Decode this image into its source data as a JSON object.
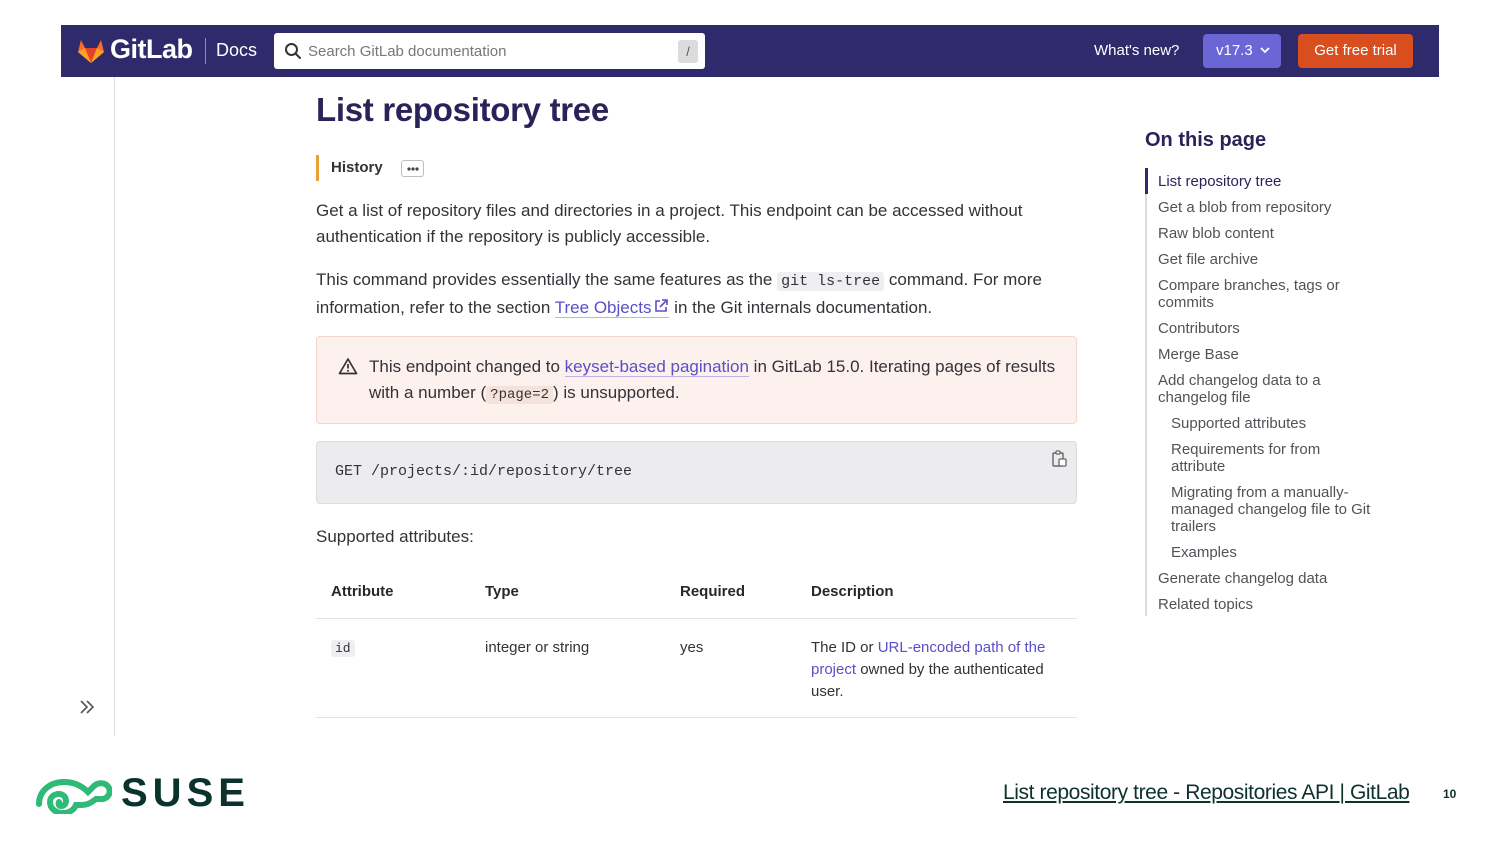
{
  "header": {
    "logo_text": "GitLab",
    "docs_label": "Docs",
    "search_placeholder": "Search GitLab documentation",
    "search_shortcut": "/",
    "whats_new": "What's new?",
    "version": "v17.3",
    "trial_button": "Get free trial"
  },
  "article": {
    "title": "List repository tree",
    "history_label": "History",
    "intro": "Get a list of repository files and directories in a project. This endpoint can be accessed without authentication if the repository is publicly accessible.",
    "p2_before": "This command provides essentially the same features as the ",
    "p2_code": "git ls-tree",
    "p2_middle": " command. For more information, refer to the section ",
    "p2_link": "Tree Objects",
    "p2_after": " in the Git internals documentation.",
    "alert_before": "This endpoint changed to ",
    "alert_link": "keyset-based pagination",
    "alert_middle": " in GitLab 15.0. Iterating pages of results with a number (",
    "alert_code": "?page=2",
    "alert_after": ") is unsupported.",
    "endpoint": "GET /projects/:id/repository/tree",
    "attrs_label": "Supported attributes:"
  },
  "table": {
    "headers": [
      "Attribute",
      "Type",
      "Required",
      "Description"
    ],
    "rows": [
      {
        "attribute": "id",
        "type": "integer or string",
        "required": "yes",
        "desc_before": "The ID or ",
        "desc_link": "URL-encoded path of the project",
        "desc_after": " owned by the authenticated user."
      }
    ]
  },
  "toc": {
    "title": "On this page",
    "items": [
      "List repository tree",
      "Get a blob from repository",
      "Raw blob content",
      "Get file archive",
      "Compare branches, tags or commits",
      "Contributors",
      "Merge Base",
      "Add changelog data to a changelog file",
      "Supported attributes",
      "Requirements for from attribute",
      "Migrating from a manually-managed changelog file to Git trailers",
      "Examples",
      "Generate changelog data",
      "Related topics"
    ]
  },
  "footer": {
    "brand": "SUSE",
    "source_link": "List repository tree - Repositories API | GitLab",
    "page_number": "10"
  },
  "colors": {
    "header_bg": "#2f2a6b",
    "version_btn": "#6b66d6",
    "trial_btn": "#d84e1f",
    "link": "#5a4fc6",
    "suse_green": "#30ba78"
  }
}
